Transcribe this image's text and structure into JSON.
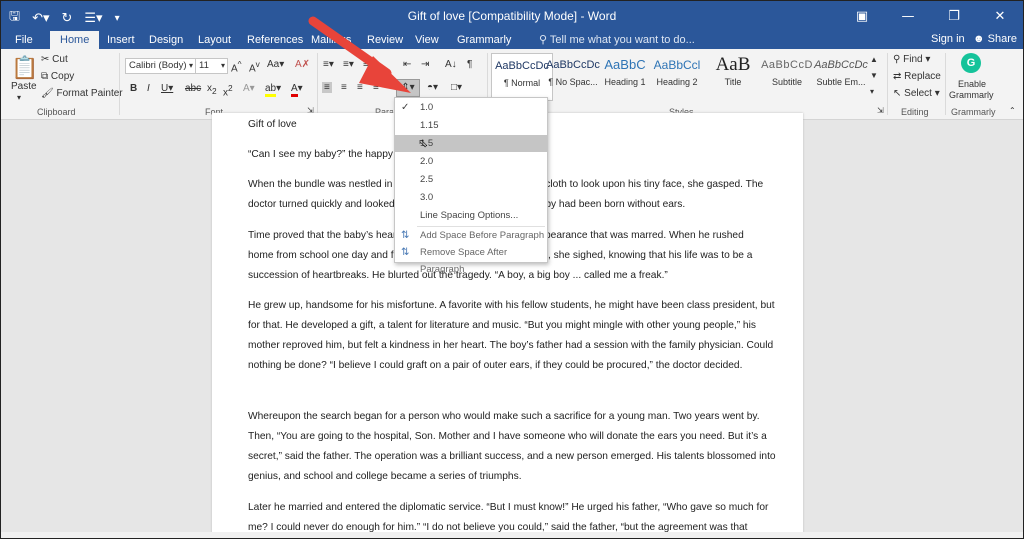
{
  "titlebar": {
    "title": "Gift of love [Compatibility Mode] - Word",
    "qat": [
      "save-icon",
      "undo-icon",
      "redo-icon",
      "bullets-icon",
      "customize-icon"
    ]
  },
  "tabs": [
    {
      "label": "File"
    },
    {
      "label": "Home"
    },
    {
      "label": "Insert"
    },
    {
      "label": "Design"
    },
    {
      "label": "Layout"
    },
    {
      "label": "References"
    },
    {
      "label": "Mailings"
    },
    {
      "label": "Review"
    },
    {
      "label": "View"
    },
    {
      "label": "Grammarly"
    }
  ],
  "tellme": "Tell me what you want to do...",
  "signin": "Sign in",
  "share": "Share",
  "clipboard": {
    "paste": "Paste",
    "cut": "Cut",
    "copy": "Copy",
    "format_painter": "Format Painter",
    "label": "Clipboard"
  },
  "font": {
    "name": "Calibri (Body)",
    "size": "11",
    "label": "Font"
  },
  "paragraph": {
    "label": "Paragraph"
  },
  "styles": {
    "label": "Styles",
    "items": [
      {
        "preview": "AaBbCcDc",
        "name": "¶ Normal"
      },
      {
        "preview": "AaBbCcDc",
        "name": "¶ No Spac..."
      },
      {
        "preview": "AaBbC",
        "name": "Heading 1"
      },
      {
        "preview": "AaBbCcl",
        "name": "Heading 2"
      },
      {
        "preview": "AaB",
        "name": "Title"
      },
      {
        "preview": "AaBbCcD",
        "name": "Subtitle"
      },
      {
        "preview": "AaBbCcDc",
        "name": "Subtle Em..."
      }
    ]
  },
  "editing": {
    "find": "Find",
    "replace": "Replace",
    "select": "Select",
    "label": "Editing"
  },
  "grammarly": {
    "enable": "Enable",
    "name": "Grammarly",
    "label": "Grammarly"
  },
  "line_spacing_menu": {
    "items": [
      {
        "label": "1.0",
        "checked": true
      },
      {
        "label": "1.15"
      },
      {
        "label": "1.5"
      },
      {
        "label": "2.0"
      },
      {
        "label": "2.5"
      },
      {
        "label": "3.0"
      }
    ],
    "options": "Line Spacing Options...",
    "add_before": "Add Space Before Paragraph",
    "remove_after": "Remove Space After Paragraph"
  },
  "document": {
    "title": "Gift of love",
    "p1": "“Can I see my baby?” the happy n",
    "p2a": "When the bundle was nestled in",
    "p2b": "of cloth to look upon his tiny face, she gasped. The",
    "p2c": "doctor turned quickly and looked",
    "p2d": "baby had been born without ears.",
    "p3a": "Time proved that the baby’s hear",
    "p3b": "pearance that was marred. When he rushed",
    "p3c": "home from school one day and fl",
    "p3d": ", she sighed, knowing that his life was to be a",
    "p3e": "succession of heartbreaks. He blurted out the tragedy. “A boy, a big boy ... called me a freak.”",
    "p4": "He grew up, handsome for his misfortune. A favorite with his fellow students, he might have been class president, but for that. He developed a gift, a talent for literature and music. “But you might mingle with other young people,” his mother reproved him, but felt a kindness in her heart. The boy’s father had a session with the family physician. Could nothing be done? “I believe I could graft on a pair of outer ears, if they could be procured,” the doctor decided.",
    "p5": "Whereupon the search began for a person who would make such a sacrifice for a young man. Two years went by. Then, “You are going to the hospital, Son. Mother and I have someone who will donate the ears you need. But it’s a secret,” said the father. The operation was a brilliant success, and a new person emerged. His talents blossomed into genius, and school and college became a series of triumphs.",
    "p6": "Later he married and entered the diplomatic service. “But I must know!” He urged his father, “Who gave so much for me? I could never do enough for him.” “I do not believe you could,” said the father, “but the agreement was that"
  },
  "colors": {
    "accent": "#2b579a",
    "arrow": "#e8443a"
  }
}
